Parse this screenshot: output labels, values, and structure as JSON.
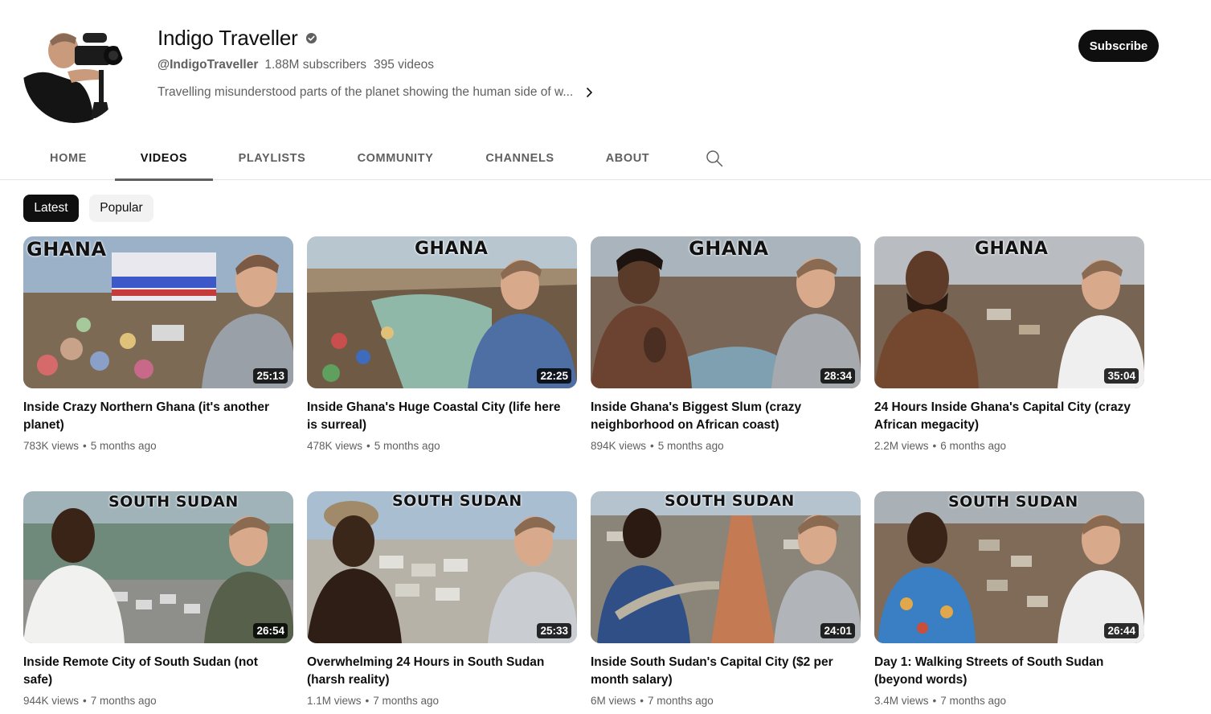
{
  "channel": {
    "name": "Indigo Traveller",
    "handle": "@IndigoTraveller",
    "subscribers": "1.88M subscribers",
    "video_count": "395 videos",
    "description": "Travelling misunderstood parts of the planet showing the human side of w...",
    "verified_icon": "verified-check-icon",
    "subscribe_label": "Subscribe"
  },
  "tabs": [
    {
      "label": "HOME"
    },
    {
      "label": "VIDEOS"
    },
    {
      "label": "PLAYLISTS"
    },
    {
      "label": "COMMUNITY"
    },
    {
      "label": "CHANNELS"
    },
    {
      "label": "ABOUT"
    }
  ],
  "active_tab": "VIDEOS",
  "chips": [
    {
      "label": "Latest"
    },
    {
      "label": "Popular"
    }
  ],
  "selected_chip": "Latest",
  "videos": [
    {
      "thumb_text": "GHANA",
      "duration": "25:13",
      "title": "Inside Crazy Northern Ghana (it's another planet)",
      "views": "783K views",
      "age": "5 months ago"
    },
    {
      "thumb_text": "GHANA",
      "duration": "22:25",
      "title": "Inside Ghana's Huge Coastal City (life here is surreal)",
      "views": "478K views",
      "age": "5 months ago"
    },
    {
      "thumb_text": "GHANA",
      "duration": "28:34",
      "title": "Inside Ghana's Biggest Slum (crazy neighborhood on African coast)",
      "views": "894K views",
      "age": "5 months ago"
    },
    {
      "thumb_text": "GHANA",
      "duration": "35:04",
      "title": "24 Hours Inside Ghana's Capital City (crazy African megacity)",
      "views": "2.2M views",
      "age": "6 months ago"
    },
    {
      "thumb_text": "SOUTH SUDAN",
      "duration": "26:54",
      "title": "Inside Remote City of South Sudan (not safe)",
      "views": "944K views",
      "age": "7 months ago"
    },
    {
      "thumb_text": "SOUTH SUDAN",
      "duration": "25:33",
      "title": "Overwhelming 24 Hours in South Sudan (harsh reality)",
      "views": "1.1M views",
      "age": "7 months ago"
    },
    {
      "thumb_text": "SOUTH SUDAN",
      "duration": "24:01",
      "title": "Inside South Sudan's Capital City ($2 per month salary)",
      "views": "6M views",
      "age": "7 months ago"
    },
    {
      "thumb_text": "SOUTH SUDAN",
      "duration": "26:44",
      "title": "Day 1: Walking Streets of South Sudan (beyond words)",
      "views": "3.4M views",
      "age": "7 months ago"
    }
  ],
  "stats_separator": "•",
  "colors": {
    "text_primary": "#0f0f0f",
    "text_secondary": "#606060",
    "chip_bg": "#f2f2f2",
    "subscribe_bg": "#0f0f0f"
  }
}
